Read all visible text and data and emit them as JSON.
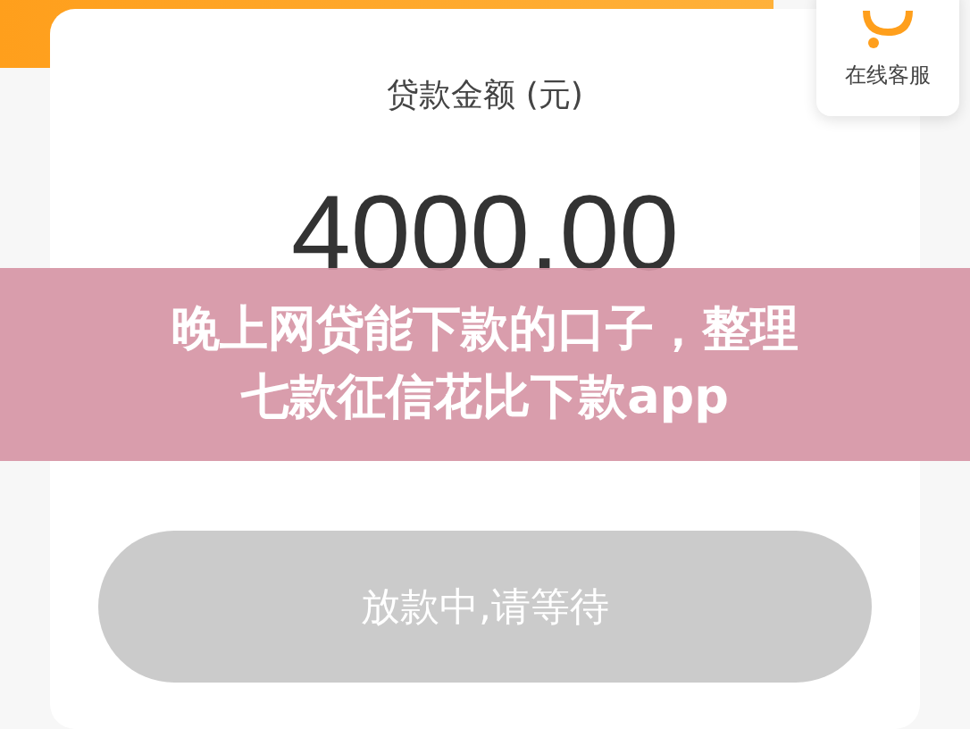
{
  "support": {
    "label": "在线客服"
  },
  "card": {
    "amount_label": "贷款金额 (元)",
    "amount": "4000.00"
  },
  "button": {
    "label": "放款中,请等待",
    "disabled": true
  },
  "banner": {
    "lines": [
      "晚上网贷能下款的口子，整理",
      "七款征信花比下款app"
    ]
  }
}
